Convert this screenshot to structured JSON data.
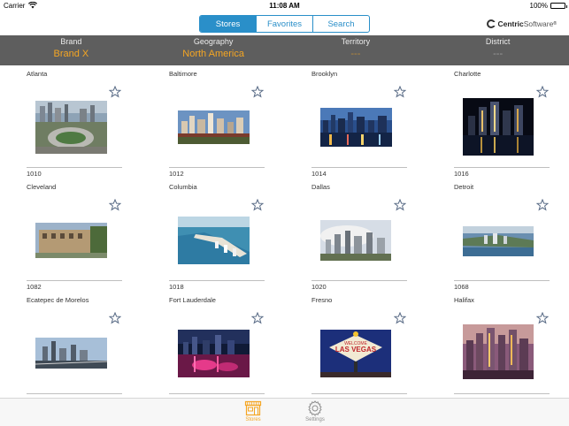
{
  "status_bar": {
    "carrier": "Carrier",
    "time": "11:08 AM",
    "battery": "100%"
  },
  "nav": {
    "segments": [
      "Stores",
      "Favorites",
      "Search"
    ],
    "active_segment": "Stores",
    "logo_bold": "Centric",
    "logo_light": "Software",
    "logo_mark": "®"
  },
  "filters": [
    {
      "label": "Brand",
      "value": "Brand X"
    },
    {
      "label": "Geography",
      "value": "North America"
    },
    {
      "label": "Territory",
      "value": "---"
    },
    {
      "label": "District",
      "value": "---"
    }
  ],
  "stores": [
    {
      "name": "Atlanta",
      "code": "1010",
      "image": "atlanta-stadium-aerial-photo"
    },
    {
      "name": "Baltimore",
      "code": "1012",
      "image": "baltimore-skyline-photo"
    },
    {
      "name": "Brooklyn",
      "code": "1014",
      "image": "brooklyn-skyline-photo"
    },
    {
      "name": "Charlotte",
      "code": "1016",
      "image": "charlotte-night-skyline-photo"
    },
    {
      "name": "Cleveland",
      "code": "1082",
      "image": "cleveland-building-photo"
    },
    {
      "name": "Columbia",
      "code": "1018",
      "image": "columbia-coastline-aerial-photo"
    },
    {
      "name": "Dallas",
      "code": "1020",
      "image": "dallas-skyline-photo"
    },
    {
      "name": "Detroit",
      "code": "1068",
      "image": "detroit-aerial-photo"
    },
    {
      "name": "Ecatepec de Morelos",
      "code": "",
      "image": "ecatepec-city-photo"
    },
    {
      "name": "Fort Lauderdale",
      "code": "",
      "image": "fort-lauderdale-night-photo"
    },
    {
      "name": "Fresno",
      "code": "",
      "image": "las-vegas-sign-photo"
    },
    {
      "name": "Halifax",
      "code": "",
      "image": "halifax-sunset-skyline-photo"
    }
  ],
  "tabs": [
    {
      "label": "Stores",
      "icon": "store-icon",
      "active": true
    },
    {
      "label": "Settings",
      "icon": "gear-icon",
      "active": false
    }
  ],
  "colors": {
    "accent_blue": "#2a8fc9",
    "accent_orange": "#f5a623",
    "filter_bar": "#5e5e5e"
  }
}
